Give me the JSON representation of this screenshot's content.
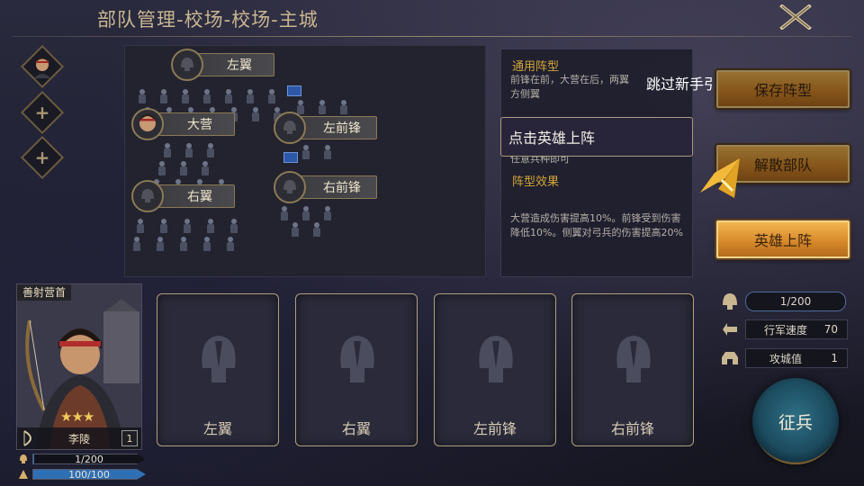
{
  "header": {
    "title": "部队管理-校场-校场-主城",
    "close_icon": "close-x-icon"
  },
  "formation": {
    "units": [
      {
        "id": "left-wing",
        "label": "左翼"
      },
      {
        "id": "main-camp",
        "label": "大营"
      },
      {
        "id": "left-vanguard",
        "label": "左前锋"
      },
      {
        "id": "right-wing",
        "label": "右翼"
      },
      {
        "id": "right-vanguard",
        "label": "右前锋"
      }
    ]
  },
  "info": {
    "general_title": "通用阵型",
    "general_desc": "前锋在前，大营在后，两翼",
    "general_desc2": "方侧翼",
    "hidden_hint": "任意兵种即可",
    "effect_title": "阵型效果",
    "effect_desc": "大营造成伤害提高10%。前锋受到伤害降低10%。侧翼对弓兵的伤害提高20%"
  },
  "guide": {
    "hint": "点击英雄上阵",
    "skip": "跳过新手引导"
  },
  "buttons": {
    "save": "保存阵型",
    "disband": "解散部队",
    "deploy": "英雄上阵",
    "levy": "征兵"
  },
  "hero": {
    "caption": "善射营首",
    "name": "李陵",
    "level": "1",
    "stars": 3,
    "stars_text": "★★★",
    "troops": "1/200",
    "troops_fraction": 0.005,
    "stamina": "100/100",
    "stamina_fraction": 1.0
  },
  "slots": [
    "左翼",
    "右翼",
    "左前锋",
    "右前锋"
  ],
  "stats": {
    "troops": "1/200",
    "march_speed_label": "行军速度",
    "march_speed": "70",
    "siege_label": "攻城值",
    "siege": "1"
  },
  "colors": {
    "accent_gold": "#d88a2a",
    "bar_blue": "#2f6fb4",
    "title_gold": "#c9b790"
  }
}
